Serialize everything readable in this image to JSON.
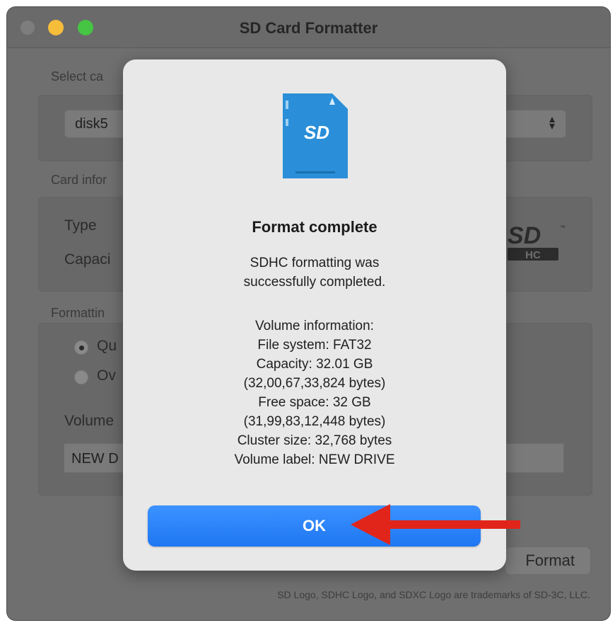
{
  "window": {
    "title": "SD Card Formatter"
  },
  "background": {
    "select_card_label": "Select ca",
    "select_card_value": "disk5",
    "card_info_label": "Card infor",
    "type_label": "Type",
    "capacity_label": "Capaci",
    "formatting_label": "Formattin",
    "quick_option_label": "Qu",
    "overwrite_option_label": "Ov",
    "volume_label": "Volume",
    "volume_value": "NEW D",
    "format_button": "Format",
    "footer": "SD Logo, SDHC Logo, and SDXC Logo are trademarks of SD-3C, LLC."
  },
  "dialog": {
    "title": "Format complete",
    "message_lines": [
      "SDHC formatting was",
      "successfully completed."
    ],
    "info_lines": [
      "Volume information:",
      "File system: FAT32",
      "Capacity: 32.01 GB",
      "(32,00,67,33,824 bytes)",
      "Free space: 32 GB",
      "(31,99,83,12,448 bytes)",
      "Cluster size: 32,768 bytes",
      "Volume label: NEW DRIVE"
    ],
    "ok_button": "OK"
  },
  "colors": {
    "accent_blue": "#1f77f3",
    "sd_card_blue": "#2a8fd8",
    "arrow_red": "#e1251b",
    "traffic_minimize": "#f6bd3b",
    "traffic_maximize": "#46c443"
  },
  "icons": {
    "dialog_icon": "sd-card-icon",
    "logo": "sdhc-logo",
    "annotation": "red-arrow-icon"
  }
}
